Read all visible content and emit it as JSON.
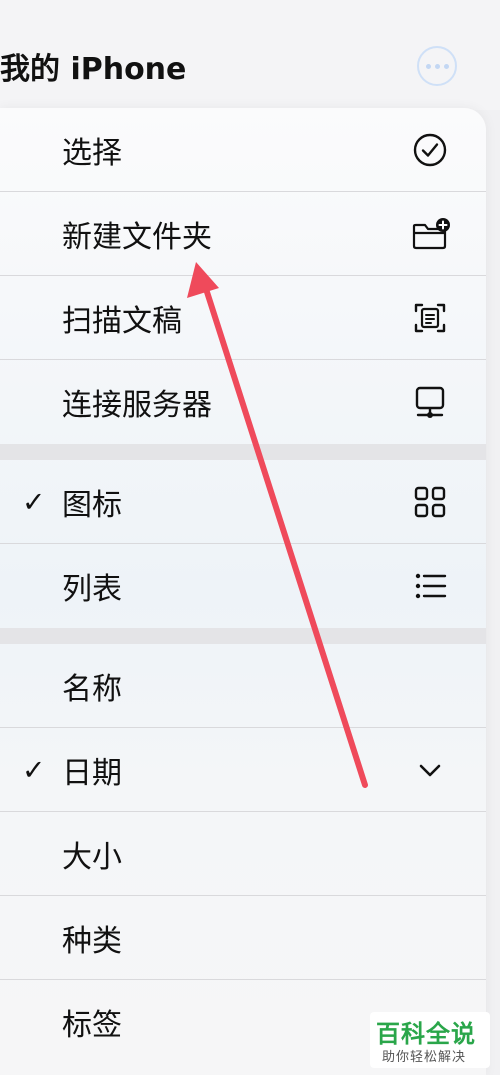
{
  "header": {
    "title": "我的 iPhone"
  },
  "menu": {
    "group1": {
      "select": "选择",
      "new_folder": "新建文件夹",
      "scan_documents": "扫描文稿",
      "connect_server": "连接服务器"
    },
    "group2": {
      "icons": "图标",
      "list": "列表"
    },
    "group3": {
      "name": "名称",
      "date": "日期",
      "size": "大小",
      "kind": "种类",
      "tags": "标签"
    },
    "checkmark": "✓"
  },
  "watermark": {
    "title": "百科全说",
    "subtitle": "助你轻松解决"
  },
  "colors": {
    "accent": "#2aa64a",
    "arrow": "#ef4a5b"
  }
}
